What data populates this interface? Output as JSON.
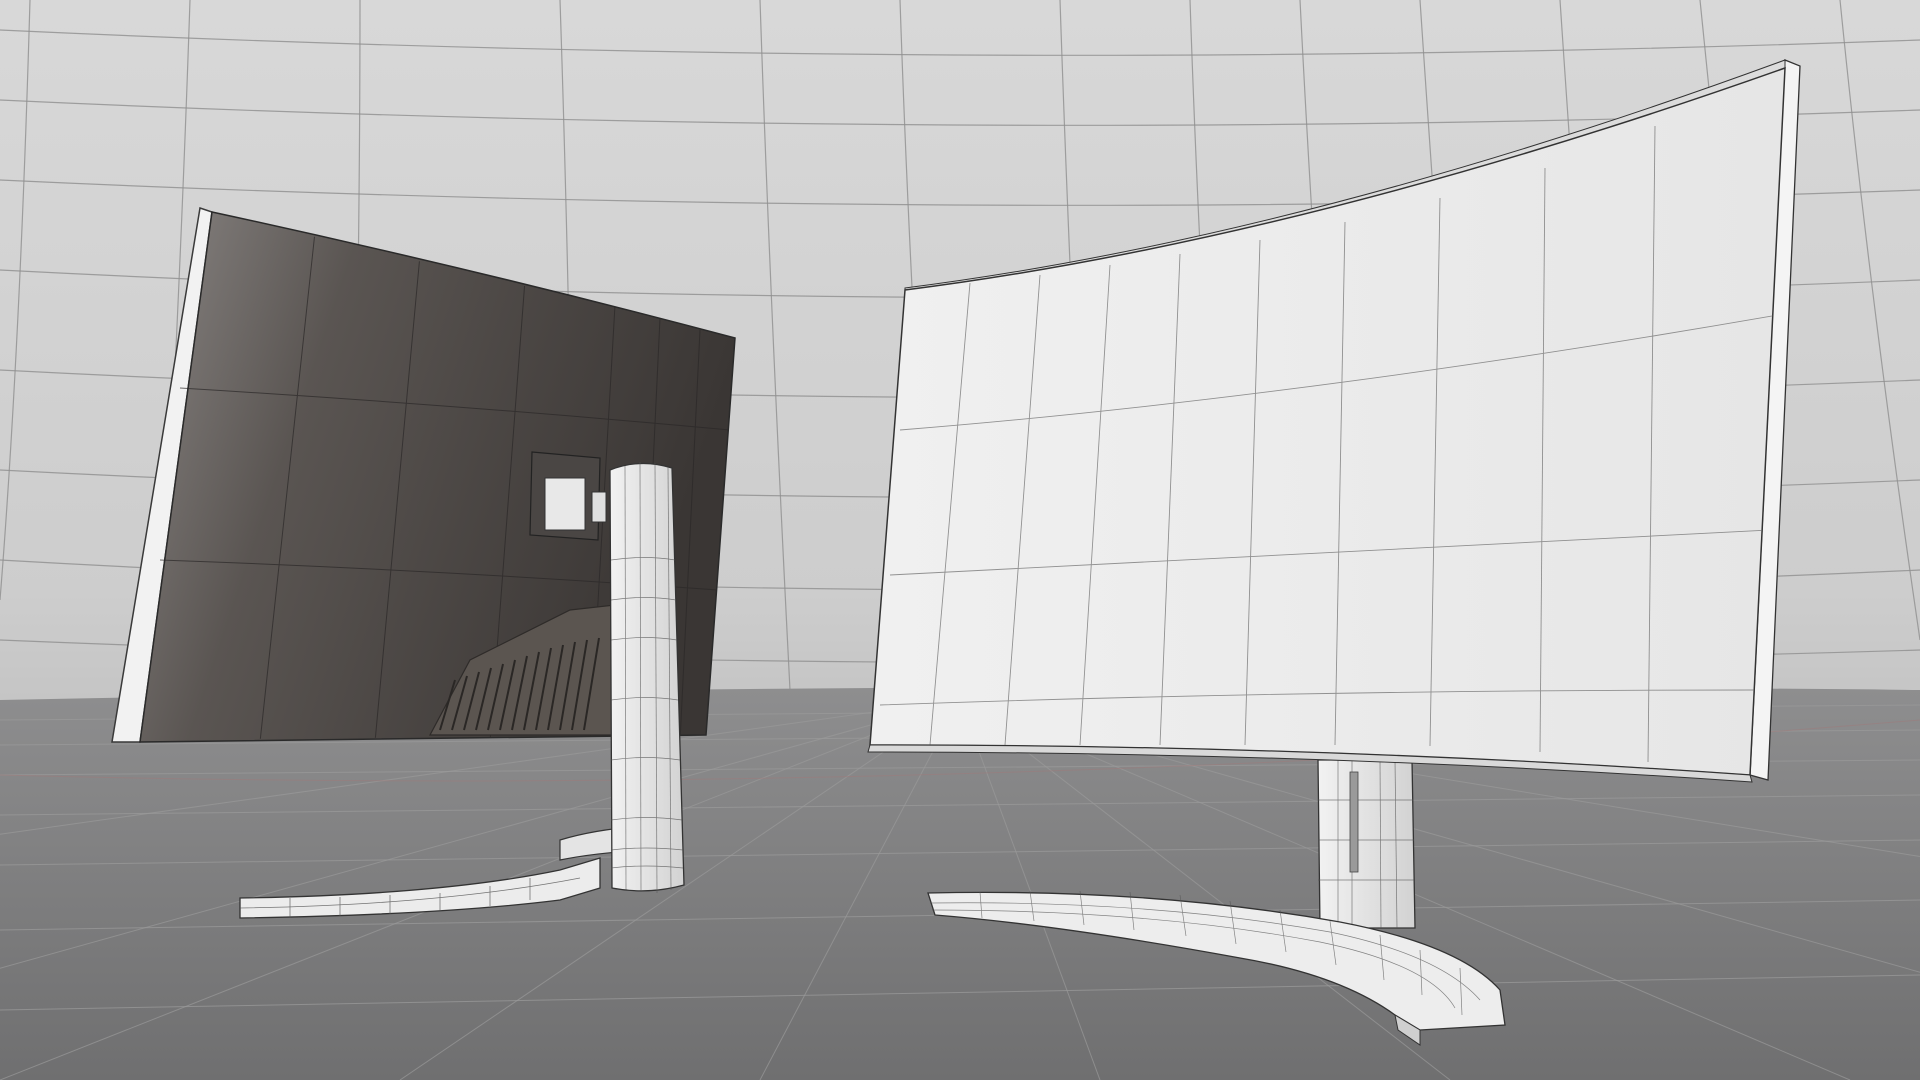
{
  "scene": {
    "colors": {
      "backdrop_top": "#d8d8d8",
      "backdrop_bottom": "#b4b4b4",
      "floor": "#7f7f80",
      "grid_line": "#8e8e8e",
      "monitor_white": "#ececec",
      "monitor_edge": "#4a4a4a",
      "back_panel_dark": "#3a3634",
      "back_panel_mid": "#6e6762",
      "wire_line": "#5c5c5c"
    },
    "objects": [
      "curved-monitor-rear-view",
      "curved-monitor-front-view"
    ]
  }
}
